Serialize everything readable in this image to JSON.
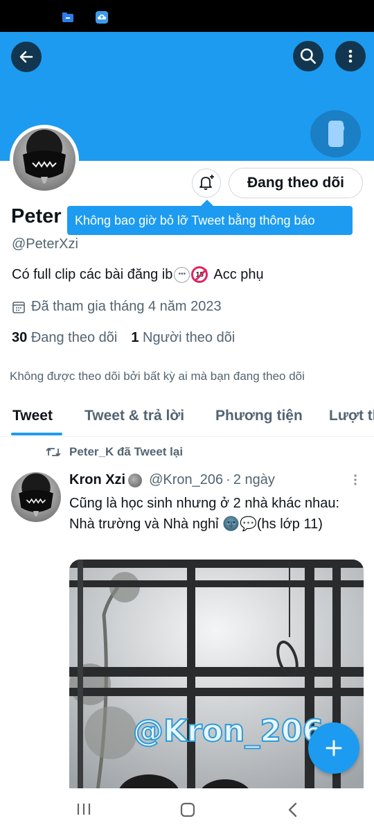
{
  "colors": {
    "accent": "#1d9bf0",
    "text": "#0f1419",
    "secondary": "#536471"
  },
  "profile": {
    "display_name": "Peter",
    "handle": "@PeterXzi",
    "bio_text": "Có full clip các bài đăng ib",
    "bio_suffix": "Acc phụ",
    "bio_emoji_18": "18",
    "joined": "Đã tham gia tháng 4 năm 2023",
    "following_count": "30",
    "following_label": "Đang theo dõi",
    "followers_count": "1",
    "followers_label": "Người theo dõi",
    "not_followed_text": "Không được theo dõi bởi bất kỳ ai mà bạn đang theo dõi"
  },
  "actions": {
    "following_button": "Đang theo dõi",
    "tooltip": "Không bao giờ bỏ lỡ Tweet bằng thông báo"
  },
  "tabs": [
    {
      "label": "Tweet"
    },
    {
      "label": "Tweet & trả lời"
    },
    {
      "label": "Phương tiện"
    },
    {
      "label": "Lượt thích"
    }
  ],
  "tweet": {
    "retweet_label": "Peter_K đã Tweet lại",
    "author_name": "Kron Xzi",
    "author_handle": "@Kron_206",
    "separator": "·",
    "time": "2 ngày",
    "text": "Cũng là học sinh nhưng ở 2 nhà khác nhau: Nhà trường và Nhà nghỉ 🌚💬(hs lớp 11)",
    "media_watermark": "@Kron_206"
  },
  "icons": {
    "back": "back-arrow-icon",
    "search": "search-icon",
    "more": "more-vertical-icon",
    "notify": "bell-plus-icon",
    "compose": "plus-icon"
  }
}
